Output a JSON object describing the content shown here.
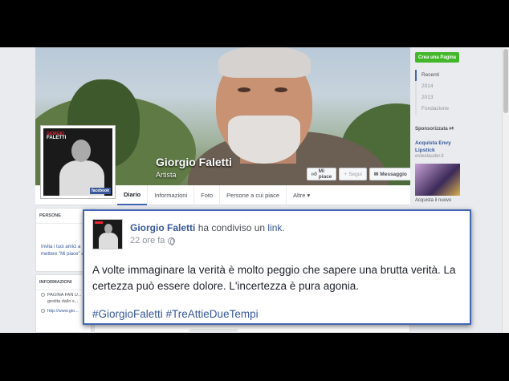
{
  "page": {
    "name": "Giorgio Faletti",
    "category": "Artista",
    "profile_pic": {
      "top_label": "GIORGIO",
      "name_label": "FALETTI",
      "badge": "facebook"
    }
  },
  "cover_actions": [
    {
      "label": "Mi piace",
      "icon": "thumbs-up-icon"
    },
    {
      "label": "Segui",
      "icon": "plus-icon"
    },
    {
      "label": "Messaggio",
      "icon": "message-icon"
    },
    {
      "label": "•••",
      "icon": "more-icon"
    }
  ],
  "nav": {
    "tabs": [
      "Diario",
      "Informazioni",
      "Foto",
      "Persone a cui piace",
      "Altre ▾"
    ]
  },
  "left": {
    "persone_title": "PERSONE",
    "invite_text": "Invita i tuoi amici a mettere \"Mi piace\" a questa Pagina",
    "info_title": "INFORMAZIONI",
    "info_rows": [
      "PAGINA FAN U... gestita dallo s...",
      "http://www.gio..."
    ]
  },
  "right": {
    "create_page": "Crea una Pagina",
    "timeline": [
      "Recenti",
      "2014",
      "2013",
      "Fondazione"
    ],
    "sponsored": "Sponsorizzata",
    "ad_title": "Acquista Envy Lipstick",
    "ad_domain": "esteelauder.it",
    "ad_text": "Acquista il nuovo"
  },
  "post": {
    "author": "Giorgio Faletti",
    "action": "ha condiviso un",
    "link_word": "link.",
    "time": "22 ore fa",
    "text": "A volte immaginare la verità è molto peggio che sapere una brutta verità. La certezza può essere dolore. L'incertezza è pura agonia.",
    "hashtags": "#GiorgioFaletti #TreAttieDueTempi"
  },
  "colors": {
    "facebook_blue": "#4267b2",
    "link_blue": "#365899",
    "create_green": "#42b72a"
  }
}
